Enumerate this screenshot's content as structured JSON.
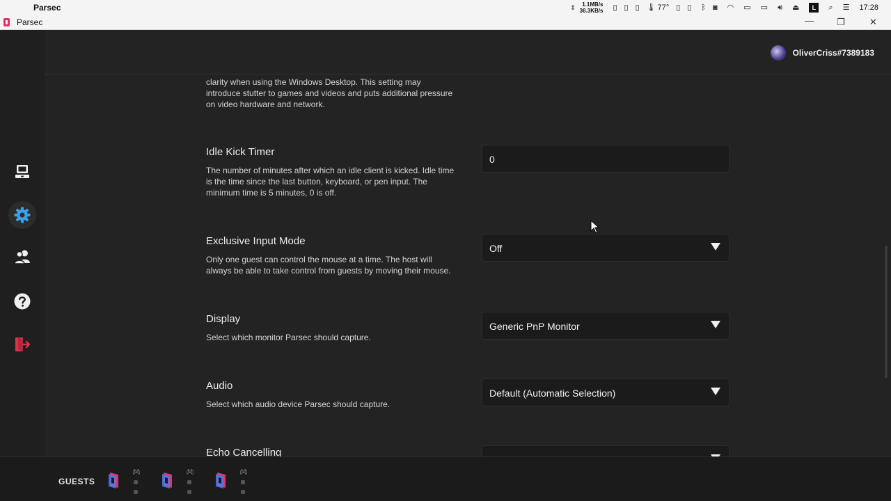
{
  "menubar": {
    "app_name": "Parsec",
    "net_up": "1.1MB/s",
    "net_down": "36.3KB/s",
    "temp": "77°",
    "clock": "17:28",
    "l_badge": "L"
  },
  "window": {
    "title": "Parsec"
  },
  "user": {
    "name": "OliverCriss#7389183"
  },
  "settings": [
    {
      "title": "",
      "desc": "clarity when using the Windows Desktop. This setting may introduce stutter to games and videos and puts additional pressure on video hardware and network.",
      "control": null
    },
    {
      "title": "Idle Kick Timer",
      "desc": "The number of minutes after which an idle client is kicked. Idle time is the time since the last button, keyboard, or pen input. The minimum time is 5 minutes, 0 is off.",
      "control": {
        "type": "input",
        "value": "0"
      }
    },
    {
      "title": "Exclusive Input Mode",
      "desc": "Only one guest can control the mouse at a time. The host will always be able to take control from guests by moving their mouse.",
      "control": {
        "type": "select",
        "value": "Off"
      }
    },
    {
      "title": "Display",
      "desc": "Select which monitor Parsec should capture.",
      "control": {
        "type": "select",
        "value": "Generic PnP Monitor"
      }
    },
    {
      "title": "Audio",
      "desc": "Select which audio device Parsec should capture.",
      "control": {
        "type": "select",
        "value": "Default (Automatic Selection)"
      }
    },
    {
      "title": "Echo Cancelling",
      "desc": "",
      "control": {
        "type": "select",
        "value": ""
      }
    }
  ],
  "guests": {
    "label": "GUESTS"
  },
  "colors": {
    "accent": "#3aa0e8",
    "brand": "#e0306e",
    "danger": "#d8334a",
    "background": "#232323"
  },
  "icons": [
    "computer-icon",
    "settings-gear-icon",
    "friends-icon",
    "help-icon",
    "logout-icon",
    "gamepad-icon"
  ]
}
